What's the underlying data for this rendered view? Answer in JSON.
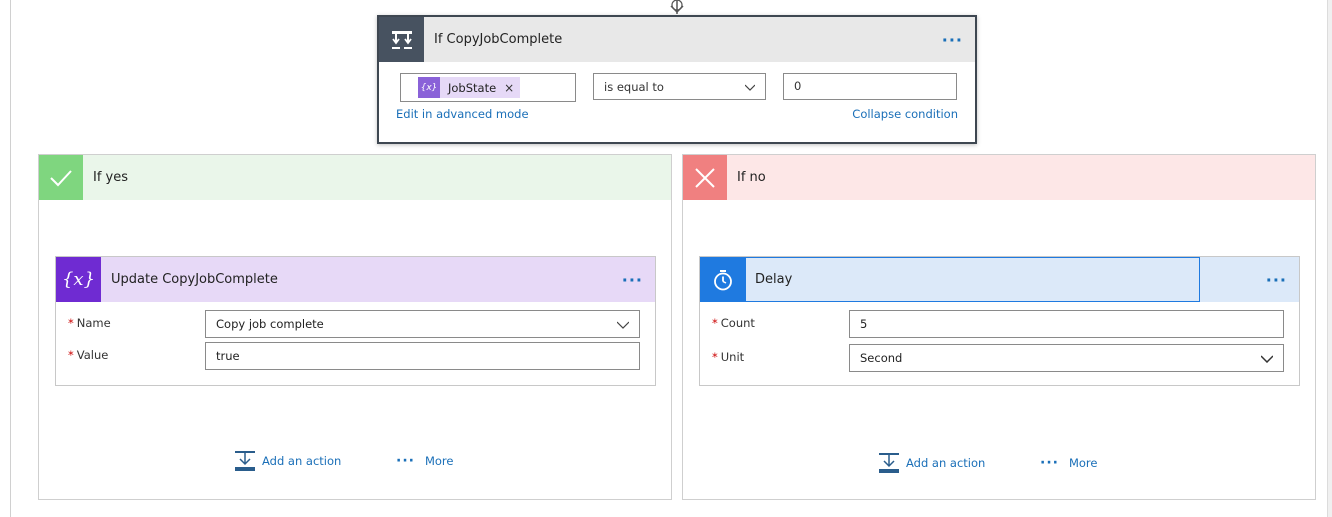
{
  "condition": {
    "title": "If CopyJobComplete",
    "menu_label": "···",
    "token": {
      "icon_text": "{x}",
      "label": "JobState",
      "remove_label": "×"
    },
    "operator": "is equal to",
    "value": "0",
    "edit_advanced_label": "Edit in advanced mode",
    "collapse_label": "Collapse condition"
  },
  "branch_yes": {
    "title": "If yes",
    "badge_icon": "checkmark-icon",
    "color": "#7fd67f",
    "action": {
      "title": "Update CopyJobComplete",
      "icon_text": "{x}",
      "menu_label": "···",
      "fields": [
        {
          "label": "Name",
          "value": "Copy job complete",
          "dropdown": true
        },
        {
          "label": "Value",
          "value": "true",
          "dropdown": false
        }
      ]
    },
    "add_action_label": "Add an action",
    "more_label": "More"
  },
  "branch_no": {
    "title": "If no",
    "badge_icon": "x-icon",
    "color": "#f08080",
    "action": {
      "title": "Delay",
      "icon": "stopwatch-icon",
      "menu_label": "···",
      "fields": [
        {
          "label": "Count",
          "value": "5",
          "dropdown": false
        },
        {
          "label": "Unit",
          "value": "Second",
          "dropdown": true
        }
      ]
    },
    "add_action_label": "Add an action",
    "more_label": "More"
  }
}
